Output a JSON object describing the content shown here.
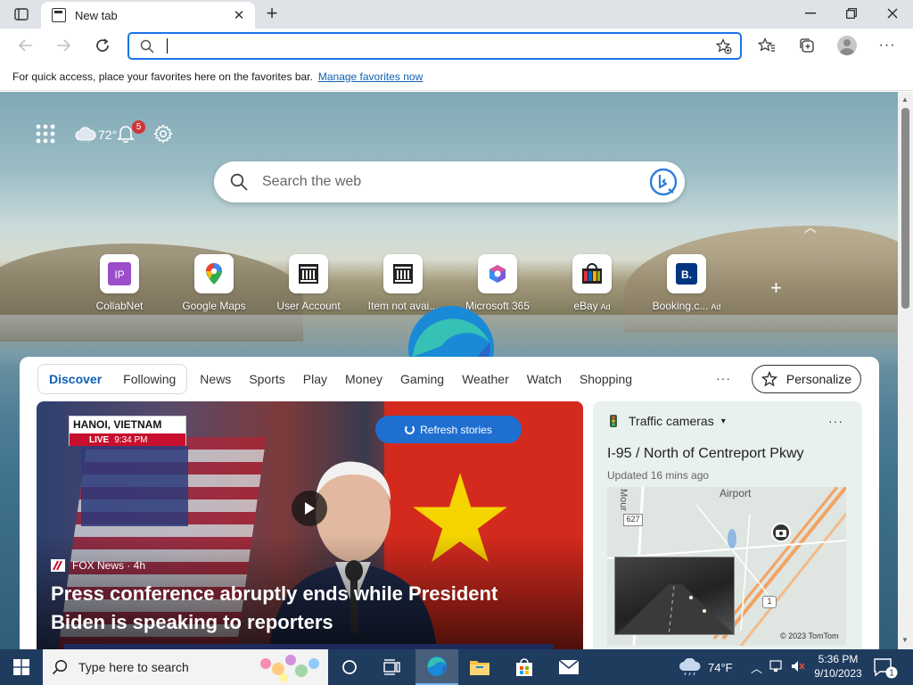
{
  "browser": {
    "tab_title": "New tab",
    "new_tab_symbol": "+",
    "window_controls": [
      "minimize",
      "restore",
      "close"
    ]
  },
  "toolbar": {
    "address_value": "",
    "address_placeholder": ""
  },
  "favorites_bar": {
    "message": "For quick access, place your favorites here on the favorites bar.",
    "link": "Manage favorites now"
  },
  "new_tab_page": {
    "weather_temp": "72°",
    "notification_count": "5",
    "search_placeholder": "Search the web",
    "quick_links": [
      {
        "label": "CollabNet",
        "icon": "ip-icon",
        "ad": ""
      },
      {
        "label": "Google Maps",
        "icon": "google-maps-icon",
        "ad": ""
      },
      {
        "label": "User Account",
        "icon": "building-icon",
        "ad": ""
      },
      {
        "label": "Item not avai...",
        "icon": "building-icon",
        "ad": ""
      },
      {
        "label": "Microsoft 365",
        "icon": "microsoft-365-icon",
        "ad": ""
      },
      {
        "label": "eBay",
        "icon": "ebay-icon",
        "ad": "Ad"
      },
      {
        "label": "Booking.c...",
        "icon": "booking-icon",
        "ad": "Ad"
      }
    ]
  },
  "feed": {
    "pill_tabs": [
      "Discover",
      "Following"
    ],
    "categories": [
      "News",
      "Sports",
      "Play",
      "Money",
      "Gaming",
      "Weather",
      "Watch",
      "Shopping"
    ],
    "more": "···",
    "personalize": "Personalize",
    "refresh_label": "Refresh stories",
    "news": {
      "location_tag": "HANOI, VIETNAM",
      "live": "LIVE",
      "time_tag": "9:34 PM",
      "source": "FOX News · 4h",
      "headline": "Press conference abruptly ends while President Biden is speaking to reporters"
    },
    "traffic": {
      "title": "Traffic cameras",
      "more": "···",
      "road": "I-95 / North of Centreport Pkwy",
      "updated": "Updated 16 mins ago",
      "map_label_airport": "Airport",
      "map_label_mou": "Mour",
      "shield_627": "627",
      "shield_1": "1",
      "copyright": "© 2023 TomTom"
    }
  },
  "taskbar": {
    "search_placeholder": "Type here to search",
    "weather": "74°F",
    "time": "5:36 PM",
    "date": "9/10/2023",
    "notification_count": "1"
  },
  "colors": {
    "accent": "#1a73e8",
    "link": "#0f61b5",
    "refresh_button": "#1f6fd1",
    "taskbar": "#1f3c5f",
    "badge": "#d13438"
  }
}
